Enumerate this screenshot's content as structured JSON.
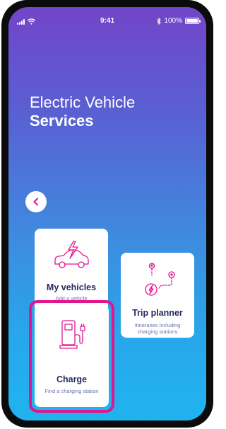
{
  "status_bar": {
    "time": "9:41",
    "battery": "100%"
  },
  "header": {
    "title_line1": "Electric Vehicle",
    "title_line2": "Services"
  },
  "cards": {
    "vehicles": {
      "label": "My vehicles",
      "sub": "Add a vehicle"
    },
    "trip": {
      "label": "Trip planner",
      "sub": "Itineraries including charging stations"
    },
    "charge": {
      "label": "Charge",
      "sub": "Find a charging station"
    }
  },
  "colors": {
    "accent": "#e0168e",
    "gradient_top": "#7245c8",
    "gradient_bottom": "#20b3ef",
    "card_title": "#25285c"
  }
}
